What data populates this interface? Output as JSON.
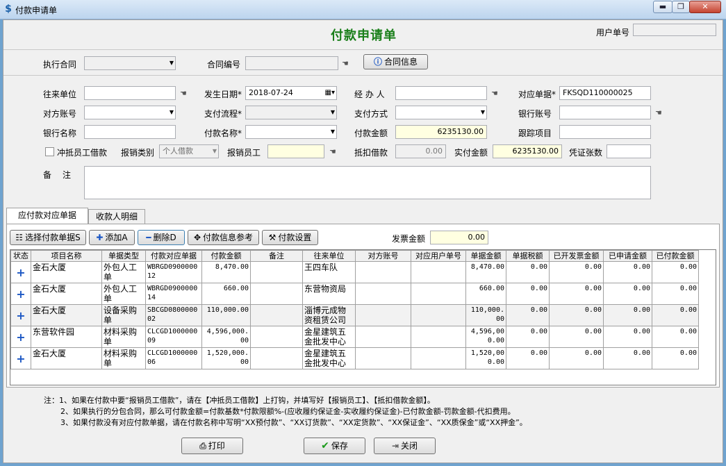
{
  "window": {
    "title": "付款申请单",
    "icon": "app-logo-icon",
    "min": "▬",
    "max": "❐",
    "close": "✕"
  },
  "header": {
    "title": "付款申请单",
    "user_no_label": "用户单号",
    "user_no_value": ""
  },
  "contract": {
    "exec_label": "执行合同",
    "exec_value": "",
    "no_label": "合同编号",
    "no_value": "",
    "info_button": "合同信息"
  },
  "fields": {
    "payee_unit_label": "往来单位",
    "payee_unit_value": "",
    "date_label": "发生日期*",
    "date_value": "2018-07-24",
    "handler_label": "经 办 人",
    "handler_value": "",
    "bill_no_label": "对应单据*",
    "bill_no_value": "FKSQD110000025",
    "other_account_label": "对方账号",
    "other_account_value": "",
    "flow_label": "支付流程*",
    "flow_value": "",
    "pay_method_label": "支付方式",
    "pay_method_value": "",
    "bank_account_label": "银行账号",
    "bank_account_value": "",
    "bank_name_label": "银行名称",
    "bank_name_value": "",
    "pay_name_label": "付款名称*",
    "pay_name_value": "",
    "pay_amount_label": "付款金额",
    "pay_amount_value": "6235130.00",
    "track_label": "跟踪项目",
    "track_value": "",
    "offset_label": "冲抵员工借款",
    "reimb_type_label": "报销类别",
    "reimb_type_value": "个人借款",
    "reimb_staff_label": "报销员工",
    "reimb_staff_value": "",
    "deduct_label": "抵扣借款",
    "deduct_value": "0.00",
    "actual_label": "实付金额",
    "actual_value": "6235130.00",
    "voucher_label": "凭证张数",
    "voucher_value": "",
    "remark_label": "备　注",
    "remark_value": ""
  },
  "tabs": [
    {
      "label": "应付款对应单据"
    },
    {
      "label": "收款人明细"
    }
  ],
  "toolbar": {
    "select_label": "选择付款单据S",
    "add_label": "添加A",
    "delete_label": "删除D",
    "ref_label": "付款信息参考",
    "settings_label": "付款设置",
    "invoice_label": "发票金额",
    "invoice_value": "0.00"
  },
  "table": {
    "headers": [
      "状态",
      "项目名称",
      "单据类型",
      "付款对应单据",
      "付款金额",
      "备注",
      "往来单位",
      "对方账号",
      "对应用户单号",
      "单据金额",
      "单据税额",
      "已开发票金额",
      "已申请金额",
      "已付款金额"
    ],
    "rows": [
      {
        "status": "+",
        "project": "金石大厦",
        "type": "外包人工单",
        "bill": "WBRGD090000012",
        "amount": "8,470.00",
        "remark": "",
        "unit": "王四车队",
        "account": "",
        "user_no": "",
        "bill_amount": "8,470.00",
        "tax": "0.00",
        "invoiced": "0.00",
        "applied": "0.00",
        "paid": "0.00"
      },
      {
        "status": "+",
        "project": "金石大厦",
        "type": "外包人工单",
        "bill": "WBRGD090000014",
        "amount": "660.00",
        "remark": "",
        "unit": "东营物资局",
        "account": "",
        "user_no": "",
        "bill_amount": "660.00",
        "tax": "0.00",
        "invoiced": "0.00",
        "applied": "0.00",
        "paid": "0.00"
      },
      {
        "status": "+",
        "project": "金石大厦",
        "type": "设备采购单",
        "bill": "SBCGD080000002",
        "amount": "110,000.00",
        "remark": "",
        "unit": "淄博元成物资租赁公司",
        "account": "",
        "user_no": "",
        "bill_amount": "110,000.00",
        "tax": "0.00",
        "invoiced": "0.00",
        "applied": "0.00",
        "paid": "0.00"
      },
      {
        "status": "+",
        "project": "东营软件园",
        "type": "材料采购单",
        "bill": "CLCGD100000009",
        "amount": "4,596,000.00",
        "remark": "",
        "unit": "金星建筑五金批发中心",
        "account": "",
        "user_no": "",
        "bill_amount": "4,596,000.00",
        "tax": "0.00",
        "invoiced": "0.00",
        "applied": "0.00",
        "paid": "0.00"
      },
      {
        "status": "+",
        "project": "金石大厦",
        "type": "材料采购单",
        "bill": "CLCGD100000006",
        "amount": "1,520,000.00",
        "remark": "",
        "unit": "金星建筑五金批发中心",
        "account": "",
        "user_no": "",
        "bill_amount": "1,520,000.00",
        "tax": "0.00",
        "invoiced": "0.00",
        "applied": "0.00",
        "paid": "0.00"
      }
    ]
  },
  "notes": [
    "注：1、如果在付款中要“报销员工借款”，请在【冲抵员工借款】上打钩，并填写好【报销员工】、【抵扣借款金额】。",
    "2、如果执行的分包合同，那么可付款金额=付款基数*付款限额%-(应收履约保证金-实收履约保证金)-已付款金额-罚款金额-代扣费用。",
    "3、如果付款没有对应付款单据，请在付款名称中写明“XX预付款”、“XX订货款”、“XX定货款”、“XX保证金”、“XX质保金”或“XX押金”。"
  ],
  "footer": {
    "print_label": "打印",
    "save_label": "保存",
    "close_label": "关闭"
  },
  "colors": {
    "title_green": "#1a7f1a",
    "highlight_yellow": "#ffffe1",
    "plus_blue": "#1c57c4"
  }
}
